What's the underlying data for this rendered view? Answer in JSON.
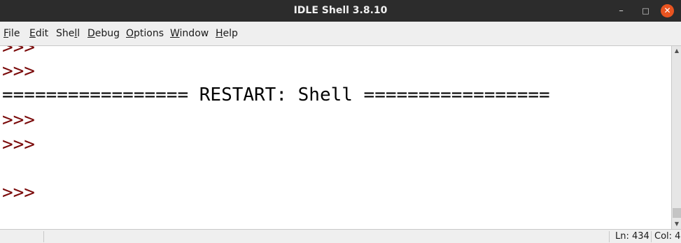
{
  "window": {
    "title": "IDLE Shell 3.8.10",
    "minimize_glyph": "–",
    "maximize_glyph": "□",
    "close_glyph": "✕"
  },
  "menubar": {
    "items": [
      {
        "mnemonic": "F",
        "rest": "ile"
      },
      {
        "mnemonic": "E",
        "rest": "dit"
      },
      {
        "pre": "She",
        "mnemonic": "l",
        "rest": "l"
      },
      {
        "mnemonic": "D",
        "rest": "ebug"
      },
      {
        "mnemonic": "O",
        "rest": "ptions"
      },
      {
        "mnemonic": "W",
        "rest": "indow"
      },
      {
        "mnemonic": "H",
        "rest": "elp"
      }
    ]
  },
  "shell": {
    "lines": [
      {
        "kind": "prompt",
        "text": ">>>"
      },
      {
        "kind": "prompt",
        "text": ">>>"
      },
      {
        "kind": "restart",
        "text": "================= RESTART: Shell ================="
      },
      {
        "kind": "prompt",
        "text": ">>>"
      },
      {
        "kind": "prompt",
        "text": ">>>"
      },
      {
        "kind": "blank",
        "text": ""
      },
      {
        "kind": "prompt",
        "text": ">>>"
      }
    ]
  },
  "scrollbar": {
    "up_glyph": "▲",
    "down_glyph": "▼"
  },
  "statusbar": {
    "line": "Ln: 434",
    "col": "Col: 4"
  },
  "colors": {
    "prompt": "#7a0a0a",
    "titlebar": "#2c2c2c",
    "close_button": "#e95420"
  }
}
